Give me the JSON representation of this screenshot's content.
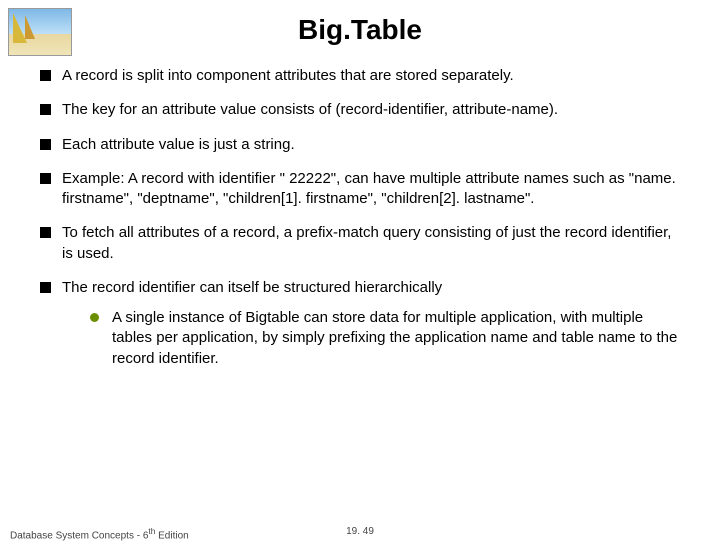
{
  "title": "Big.Table",
  "bullets": [
    "A record is split into component attributes that are stored separately.",
    "The key for an attribute value consists of (record-identifier, attribute-name).",
    "Each attribute value is just a string.",
    "Example: A record with identifier \" 22222\", can have multiple attribute names such as \"name. firstname\", \"deptname\", \"children[1]. firstname\", \"children[2]. lastname\".",
    "To fetch all attributes of a record, a prefix-match query consisting of just the record identifier, is used.",
    "The record identifier can itself be structured hierarchically"
  ],
  "subbullets": [
    "A single instance of Bigtable can store data for multiple application, with multiple tables per application, by simply prefixing the application name and table name to the record identifier."
  ],
  "footer": {
    "left_a": "Database System Concepts - 6",
    "left_b": " Edition",
    "sup": "th",
    "pagenum": "19. 49"
  }
}
